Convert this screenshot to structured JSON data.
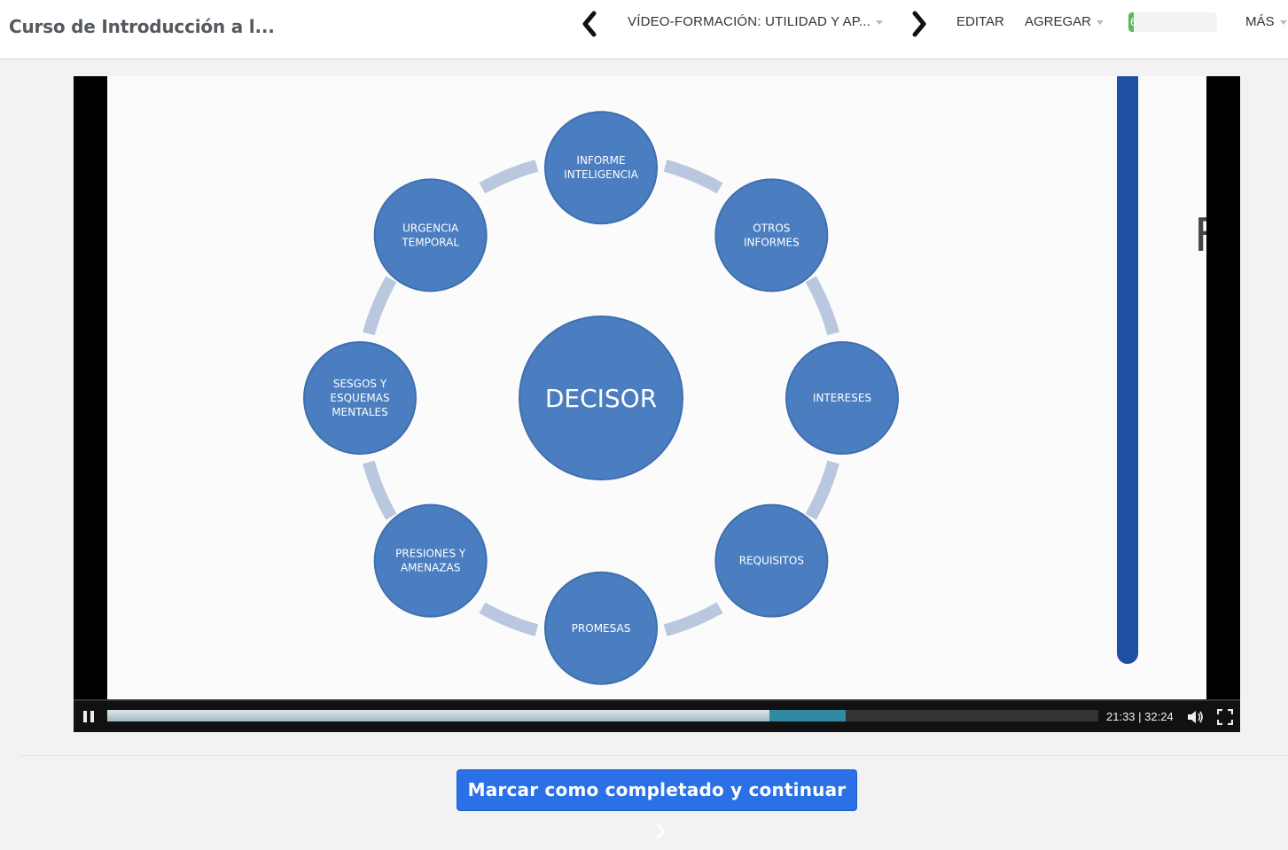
{
  "header": {
    "course_title": "Curso de Introducción a l...",
    "lesson_title": "VÍDEO-FORMACIÓN: UTILIDAD Y AP...",
    "edit_label": "EDITAR",
    "add_label": "AGREGAR",
    "more_label": "MÁS",
    "progress_text": "6",
    "progress_fraction": 0.06,
    "prev_icon": "chevron-left-icon",
    "next_icon": "chevron-right-icon"
  },
  "slide": {
    "center_label": "DECISOR",
    "nodes": [
      {
        "lines": [
          "INFORME",
          "INTELIGENCIA"
        ]
      },
      {
        "lines": [
          "OTROS",
          "INFORMES"
        ]
      },
      {
        "lines": [
          "INTERESES"
        ]
      },
      {
        "lines": [
          "REQUISITOS"
        ]
      },
      {
        "lines": [
          "PROMESAS"
        ]
      },
      {
        "lines": [
          "PRESIONES Y",
          "AMENAZAS"
        ]
      },
      {
        "lines": [
          "SESGOS Y",
          "ESQUEMAS",
          "MENTALES"
        ]
      },
      {
        "lines": [
          "URGENCIA",
          "TEMPORAL"
        ]
      }
    ],
    "partial_letter": "F",
    "node_color": "#4a7ec0",
    "ring_color": "#b9c8de",
    "bar_color": "#1f4fa3"
  },
  "player": {
    "time_display": "21:33 | 32:24",
    "played_fraction": 0.6686,
    "buffered_fraction": 0.745,
    "pause_icon": "pause-icon",
    "volume_icon": "volume-icon",
    "fullscreen_icon": "fullscreen-icon"
  },
  "footer": {
    "cta_label": "Marcar como completado y continuar"
  }
}
